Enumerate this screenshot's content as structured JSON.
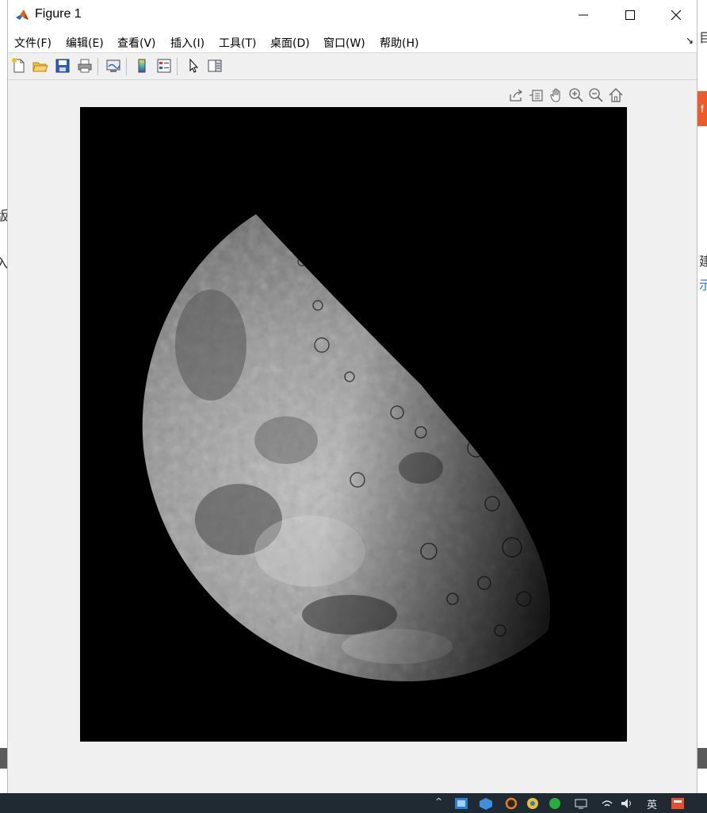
{
  "window": {
    "title": "Figure 1",
    "minimize_label": "Minimize",
    "maximize_label": "Maximize",
    "close_label": "Close"
  },
  "menu": [
    {
      "label": "文件(F)"
    },
    {
      "label": "编辑(E)"
    },
    {
      "label": "查看(V)"
    },
    {
      "label": "插入(I)"
    },
    {
      "label": "工具(T)"
    },
    {
      "label": "桌面(D)"
    },
    {
      "label": "窗口(W)"
    },
    {
      "label": "帮助(H)"
    }
  ],
  "toolbar": {
    "icons": [
      "new-figure-icon",
      "open-file-icon",
      "save-icon",
      "print-icon",
      "link-plot-icon",
      "insert-colorbar-icon",
      "insert-legend-icon",
      "edit-plot-pointer-icon",
      "property-inspector-icon"
    ]
  },
  "axes_toolbar": {
    "icons": [
      "export-icon",
      "brush-data-icon",
      "pan-hand-icon",
      "zoom-in-icon",
      "zoom-out-icon",
      "restore-view-home-icon"
    ]
  },
  "image": {
    "subject": "moon",
    "colormap": "gray"
  },
  "background": {
    "left_glyphs": [
      "版",
      "，",
      "入"
    ],
    "right_glyphs": [
      "目",
      "建",
      "示"
    ],
    "right_badge": "f",
    "taskbar_text": "英"
  },
  "colors": {
    "window_bg": "#f0f0f0",
    "titlebar_bg": "#ffffff",
    "axes_bg": "#000000",
    "taskbar_bg": "#1f2a33",
    "badge_orange": "#f05a28"
  }
}
